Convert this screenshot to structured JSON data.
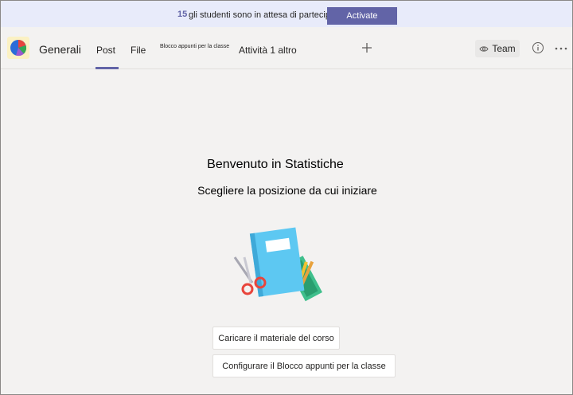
{
  "banner": {
    "count": "15",
    "text": "gli studenti sono in attesa di partecipare.",
    "activate_label": "Activate"
  },
  "header": {
    "channel_name": "Generali",
    "tabs": [
      {
        "label": "Post",
        "active": true
      },
      {
        "label": "File",
        "active": false
      },
      {
        "label": "Blocco appunti per la classe",
        "active": false
      },
      {
        "label": "Attività 1 altro",
        "active": false
      }
    ],
    "add_tab_icon": "plus-icon",
    "team_button_label": "Team",
    "info_icon": "info-icon",
    "more_icon": "more-options-icon"
  },
  "welcome": {
    "title": "Benvenuto in Statistiche",
    "subtitle": "Scegliere la posizione da cui iniziare",
    "illustration": "notebook-scissors-pencils-illustration"
  },
  "actions": {
    "upload_label": "Caricare il materiale del corso",
    "notebook_label": "Configurare il Blocco appunti per la classe"
  },
  "colors": {
    "accent": "#6264a7",
    "banner_bg": "#e8ebfa",
    "page_bg": "#f3f2f1"
  }
}
